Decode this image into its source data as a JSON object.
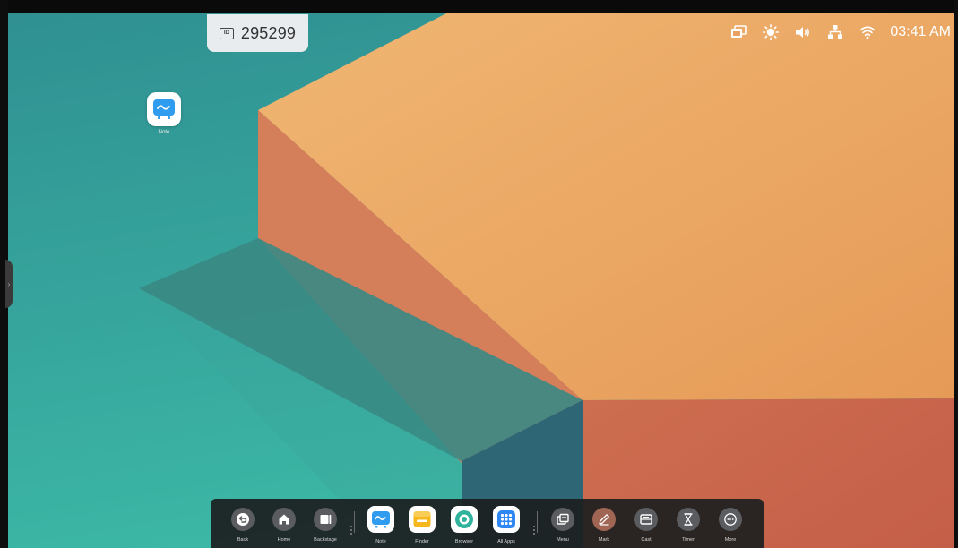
{
  "session": {
    "id_badge_icon": "id-card-icon",
    "id_number": "295299"
  },
  "status_bar": {
    "icons": [
      "screen-mirror-icon",
      "brightness-icon",
      "volume-icon",
      "network-icon",
      "wifi-icon"
    ],
    "time": "03:41 AM"
  },
  "desktop": {
    "icons": [
      {
        "label": "Note",
        "icon": "note-app-icon"
      }
    ]
  },
  "dock": {
    "items": [
      {
        "label": "Back",
        "icon": "back-icon"
      },
      {
        "label": "Home",
        "icon": "home-icon"
      },
      {
        "label": "Backstage",
        "icon": "backstage-icon"
      },
      {
        "label": "Note",
        "icon": "note-app-icon"
      },
      {
        "label": "Finder",
        "icon": "finder-app-icon"
      },
      {
        "label": "Browser",
        "icon": "browser-app-icon"
      },
      {
        "label": "All Apps",
        "icon": "all-apps-icon"
      },
      {
        "label": "Menu",
        "icon": "menu-icon"
      },
      {
        "label": "Mark",
        "icon": "mark-pen-icon"
      },
      {
        "label": "Cast",
        "icon": "cast-icon"
      },
      {
        "label": "Timer",
        "icon": "timer-hourglass-icon"
      },
      {
        "label": "More",
        "icon": "more-icon"
      }
    ]
  },
  "colors": {
    "teal": "#3aa79c",
    "orange_top": "#eeb06a",
    "orange_side": "#d27a57",
    "dock_bg": "#1c1e20",
    "note_blue": "#2f9cf0",
    "finder_yellow": "#f6b81c",
    "browser_teal": "#2fb39d",
    "apps_blue": "#2e87f3",
    "mark_bg": "#a16554"
  }
}
